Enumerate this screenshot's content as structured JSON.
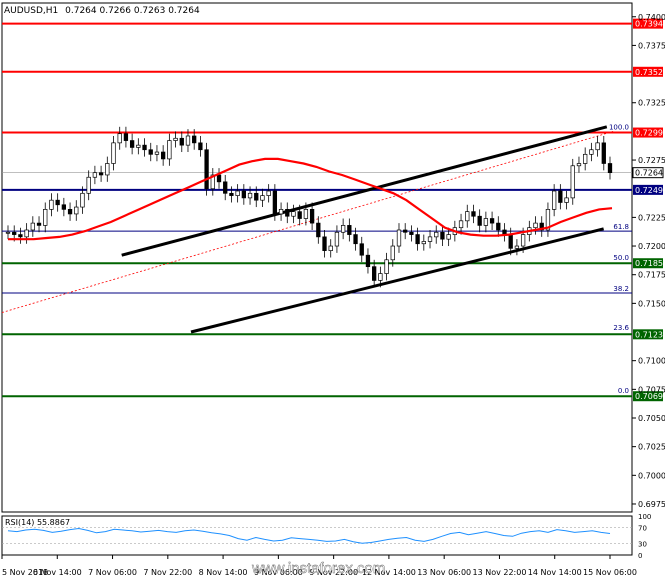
{
  "header": {
    "symbol": "AUDUSD,H1",
    "ohlc": "0.7264 0.7266 0.7263 0.7264"
  },
  "watermark": "www.instaforex.com",
  "colors": {
    "resistance": "#ff0000",
    "support": "#000080",
    "fib_level": "#006400",
    "price_tag_red": "#ff0000",
    "price_tag_green": "#006400",
    "price_tag_navy": "#000080",
    "moving_average": "#ff0000",
    "channel": "#000000",
    "rsi_line": "#1e90ff",
    "candles": "#000000"
  },
  "chart_data": {
    "type": "line",
    "title": "AUDUSD,H1",
    "ylim": [
      0.6968,
      0.7412
    ],
    "y_ticks": [
      "0.7400",
      "0.7375",
      "0.7325",
      "0.7275",
      "0.7225",
      "0.7200",
      "0.7175",
      "0.7150",
      "0.7100",
      "0.7075",
      "0.7050",
      "0.7025",
      "0.7000",
      "0.6975"
    ],
    "x_ticks": [
      "5 Nov 2018",
      "6 Nov 14:00",
      "7 Nov 06:00",
      "7 Nov 22:00",
      "8 Nov 14:00",
      "9 Nov 06:00",
      "9 Nov 22:00",
      "12 Nov 14:00",
      "13 Nov 06:00",
      "13 Nov 22:00",
      "14 Nov 14:00",
      "15 Nov 06:00"
    ],
    "horizontal_levels": [
      {
        "price": 0.7394,
        "label": "0.7394",
        "kind": "resistance"
      },
      {
        "price": 0.7352,
        "label": "0.7352",
        "kind": "resistance"
      },
      {
        "price": 0.7299,
        "label": "0.7299",
        "kind": "resistance"
      },
      {
        "price": 0.7249,
        "label": "0.7249",
        "kind": "support"
      },
      {
        "price": 0.7185,
        "label": "0.7185",
        "kind": "fib"
      },
      {
        "price": 0.7123,
        "label": "0.7123",
        "kind": "fib"
      },
      {
        "price": 0.7069,
        "label": "0.7069",
        "kind": "fib"
      }
    ],
    "current_price": "0.7264",
    "fibonacci": [
      {
        "label": "100.0",
        "price": 0.73
      },
      {
        "label": "61.8",
        "price": 0.7213
      },
      {
        "label": "50.0",
        "price": 0.7186
      },
      {
        "label": "38.2",
        "price": 0.7159
      },
      {
        "label": "23.6",
        "price": 0.7125
      },
      {
        "label": "0.0",
        "price": 0.707
      }
    ],
    "close_series": [
      0.7212,
      0.721,
      0.7208,
      0.7214,
      0.722,
      0.7218,
      0.7232,
      0.724,
      0.7236,
      0.7232,
      0.7228,
      0.7234,
      0.7246,
      0.726,
      0.7264,
      0.7262,
      0.7272,
      0.729,
      0.7298,
      0.7292,
      0.7286,
      0.7288,
      0.7284,
      0.728,
      0.7282,
      0.7276,
      0.7292,
      0.7294,
      0.7288,
      0.7296,
      0.729,
      0.7284,
      0.725,
      0.7262,
      0.7256,
      0.7246,
      0.7244,
      0.7248,
      0.7242,
      0.7246,
      0.724,
      0.7244,
      0.7248,
      0.7228,
      0.7232,
      0.7226,
      0.723,
      0.7224,
      0.7232,
      0.722,
      0.7208,
      0.7196,
      0.72,
      0.7212,
      0.7218,
      0.721,
      0.7202,
      0.7192,
      0.7182,
      0.717,
      0.7176,
      0.7188,
      0.72,
      0.7214,
      0.7212,
      0.721,
      0.7202,
      0.7204,
      0.7208,
      0.7212,
      0.7206,
      0.721,
      0.7216,
      0.7222,
      0.723,
      0.7226,
      0.7218,
      0.7224,
      0.722,
      0.7214,
      0.721,
      0.7198,
      0.72,
      0.721,
      0.7216,
      0.722,
      0.7214,
      0.7232,
      0.7248,
      0.7238,
      0.7242,
      0.727,
      0.7272,
      0.728,
      0.7284,
      0.729,
      0.7272,
      0.7264
    ],
    "moving_average": [
      0.7206,
      0.7206,
      0.7206,
      0.7207,
      0.7208,
      0.721,
      0.7213,
      0.7217,
      0.7221,
      0.7226,
      0.7231,
      0.7236,
      0.7241,
      0.7246,
      0.7251,
      0.7256,
      0.7261,
      0.7266,
      0.7271,
      0.7274,
      0.7276,
      0.7276,
      0.7274,
      0.7272,
      0.7269,
      0.7265,
      0.7262,
      0.7258,
      0.7254,
      0.725,
      0.7246,
      0.724,
      0.7232,
      0.7224,
      0.7216,
      0.7212,
      0.721,
      0.7209,
      0.7209,
      0.721,
      0.7212,
      0.7214,
      0.7216,
      0.7221,
      0.7225,
      0.7229,
      0.7232,
      0.7233
    ],
    "channel_upper": [
      [
        0.7192,
        0.19
      ],
      [
        0.7304,
        0.96
      ]
    ],
    "channel_lower": [
      [
        0.7125,
        0.3
      ],
      [
        0.7215,
        0.955
      ]
    ],
    "rsi": {
      "label": "RSI(14) 55.8867",
      "ylim": [
        0,
        100
      ],
      "levels": [
        "100",
        "70",
        "30",
        "0"
      ],
      "values": [
        62,
        60,
        64,
        66,
        63,
        58,
        61,
        65,
        68,
        63,
        57,
        60,
        66,
        64,
        62,
        59,
        61,
        63,
        60,
        58,
        62,
        64,
        61,
        57,
        54,
        50,
        42,
        38,
        45,
        40,
        36,
        38,
        44,
        42,
        40,
        38,
        35,
        36,
        40,
        34,
        30,
        32,
        36,
        40,
        43,
        45,
        38,
        35,
        40,
        48,
        55,
        58,
        52,
        56,
        60,
        55,
        50,
        48,
        56,
        60,
        62,
        58,
        65,
        62,
        58,
        60,
        62,
        58,
        55
      ]
    }
  }
}
